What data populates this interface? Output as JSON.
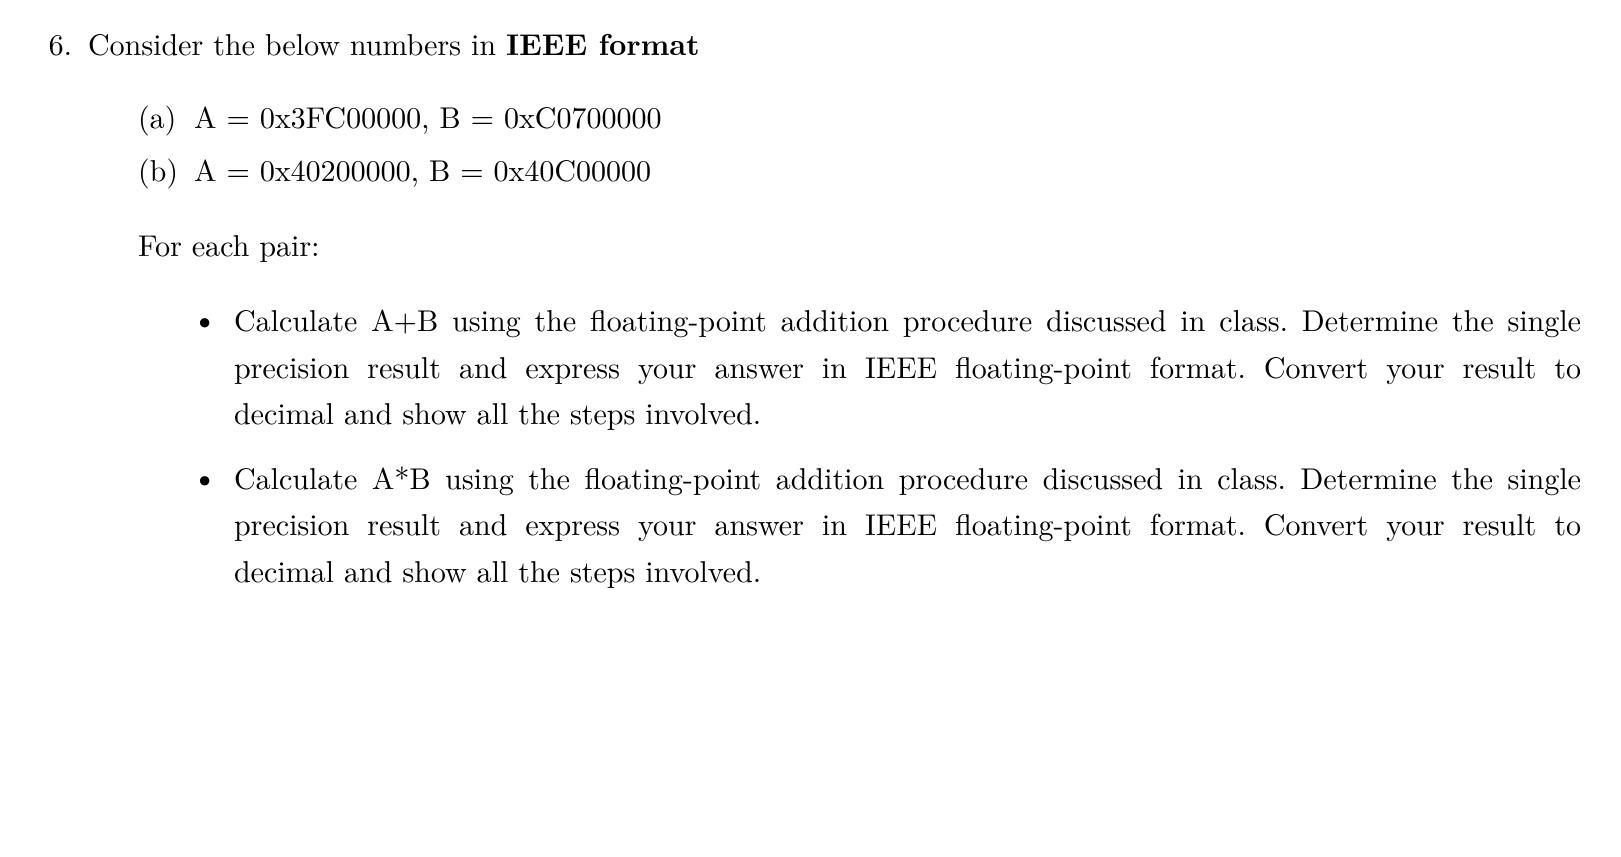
{
  "problem": {
    "number": "6.",
    "intro_prefix": "Consider the below numbers in ",
    "intro_bold": "IEEE format",
    "subs": [
      {
        "label": "(a)",
        "content": "A = 0x3FC00000, B = 0xC0700000"
      },
      {
        "label": "(b)",
        "content": "A = 0x40200000, B = 0x40C00000"
      }
    ],
    "for_each": "For each pair:",
    "bullets": [
      "Calculate A+B using the floating-point addition procedure discussed in class.  Determine the single precision result and express your answer in IEEE floating-point format.  Convert your result to decimal and show all the steps involved.",
      "Calculate A*B using the floating-point addition procedure discussed in class.  Determine the single precision result and express your answer in IEEE floating-point format.  Convert your result to decimal and show all the steps involved."
    ]
  }
}
